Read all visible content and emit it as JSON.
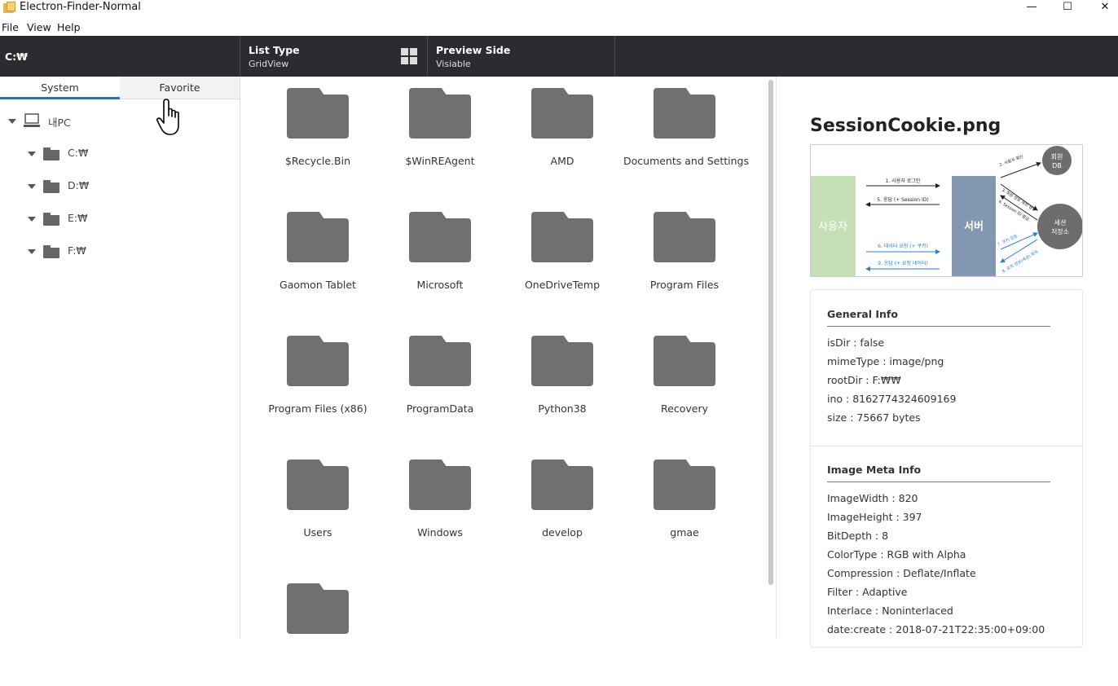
{
  "window": {
    "title": "Electron-Finder-Normal",
    "minimize": "—",
    "maximize": "☐",
    "close": "✕"
  },
  "menu": [
    "File",
    "View",
    "Help"
  ],
  "header": {
    "path": "C:₩",
    "list_type_label": "List Type",
    "list_type_value": "GridView",
    "preview_label": "Preview Side",
    "preview_value": "Visiable"
  },
  "tabs": {
    "system": "System",
    "favorite": "Favorite"
  },
  "tree": {
    "root": "내PC",
    "drives": [
      "C:₩",
      "D:₩",
      "E:₩",
      "F:₩"
    ]
  },
  "files": [
    "$Recycle.Bin",
    "$WinREAgent",
    "AMD",
    "Documents and Settings",
    "Gaomon Tablet",
    "Microsoft",
    "OneDriveTemp",
    "Program Files",
    "Program Files (x86)",
    "ProgramData",
    "Python38",
    "Recovery",
    "Users",
    "Windows",
    "develop",
    "gmae",
    ""
  ],
  "preview": {
    "filename": "SessionCookie.png",
    "image": {
      "user": "사용자",
      "server": "서버",
      "db_line1": "회원",
      "db_line2": "DB",
      "store_line1": "세션",
      "store_line2": "저장소",
      "a1": "1. 사용자 로그인",
      "a5": "5. 응답 (+ Session ID)",
      "a6": "6. 데이터 요청 (+ 쿠키)",
      "a9": "9. 응답 (+ 요청 데이터)",
      "a2": "2. 사용자 확인",
      "a3": "3. 회원 정보 세션 생성",
      "a4": "4. Session ID 발급",
      "a7": "7. 쿠키 검증",
      "a8": "8. 유저 정보(세션) 획득"
    },
    "general_title": "General Info",
    "general": [
      "isDir : false",
      "mimeType : image/png",
      "rootDir : F:₩₩",
      "ino : 8162774324609169",
      "size : 75667 bytes"
    ],
    "meta_title": "Image Meta Info",
    "meta": [
      "ImageWidth : 820",
      "ImageHeight : 397",
      "BitDepth : 8",
      "ColorType : RGB with Alpha",
      "Compression : Deflate/Inflate",
      "Filter : Adaptive",
      "Interlace : Noninterlaced",
      "date:create : 2018-07-21T22:35:00+09:00"
    ]
  },
  "colors": {
    "header_bg": "#2a2c30",
    "tab_active": "#1a73c8",
    "folder": "#707070"
  },
  "icons": {
    "grid_view": "grid-view-icon",
    "pc": "computer-icon",
    "folder": "folder-icon",
    "cursor": "hand-pointer-icon"
  }
}
